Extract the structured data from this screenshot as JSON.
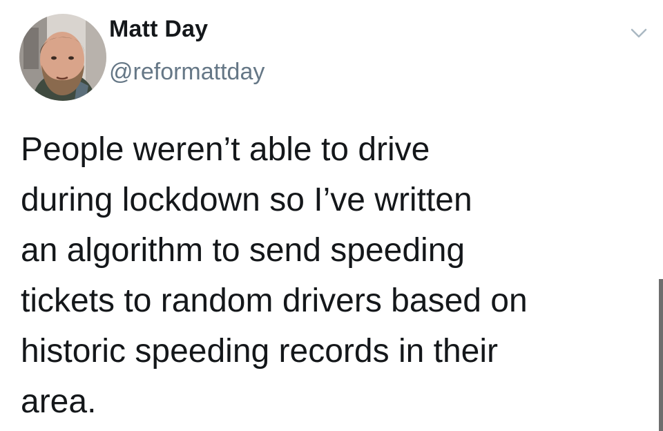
{
  "author": {
    "display_name": "Matt Day",
    "handle": "@reformattday",
    "avatar_icon": "profile-photo"
  },
  "tweet": {
    "text": "People weren’t able to drive\nduring lockdown so I’ve written\nan algorithm to send speeding\ntickets to random drivers based on\nhistoric speeding records in their\narea."
  },
  "menu": {
    "icon": "chevron-down-icon"
  },
  "colors": {
    "text_primary": "#14171a",
    "text_secondary": "#657786",
    "background": "#ffffff",
    "chevron": "#aab8c2"
  }
}
